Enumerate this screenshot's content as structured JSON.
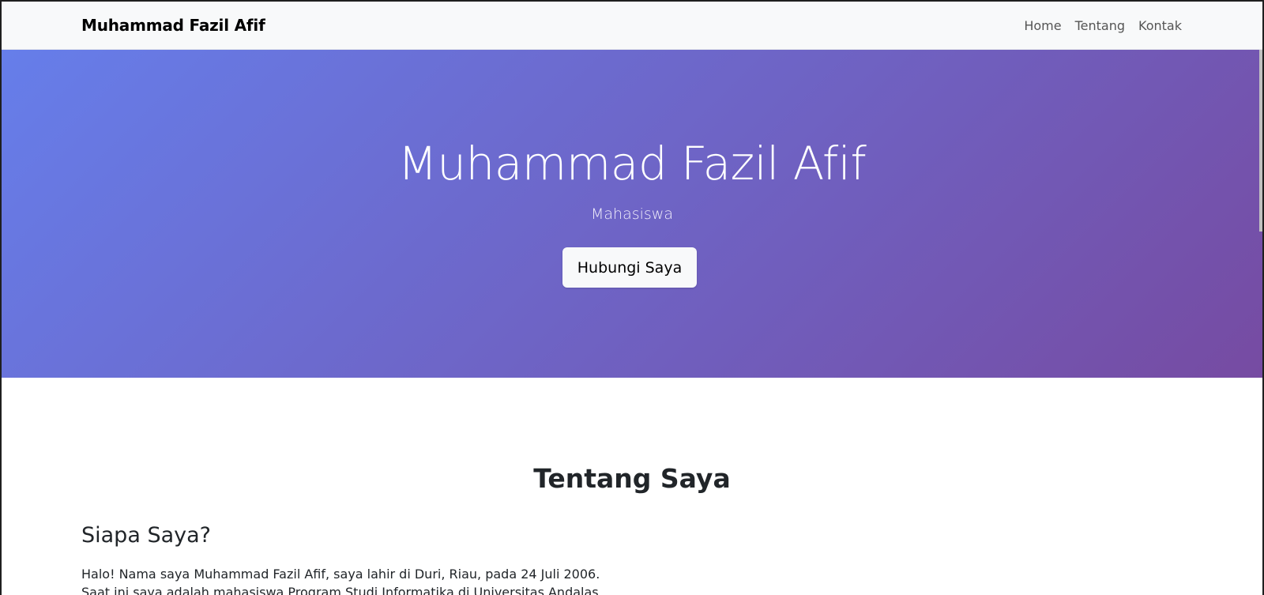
{
  "navbar": {
    "brand": "Muhammad Fazil Afif",
    "links": [
      "Home",
      "Tentang",
      "Kontak"
    ]
  },
  "hero": {
    "title": "Muhammad Fazil Afif",
    "subtitle": "Mahasiswa",
    "button_label": "Hubungi Saya"
  },
  "about": {
    "heading": "Tentang Saya",
    "subheading": "Siapa Saya?",
    "paragraph": "Halo! Nama saya Muhammad Fazil Afif, saya lahir di Duri, Riau, pada 24 Juli 2006. Saat ini saya adalah mahasiswa Program Studi Informatika di Universitas Andalas. Saya memiliki"
  },
  "colors": {
    "hero_gradient_start": "#667eea",
    "hero_gradient_end": "#764ba2",
    "navbar_bg": "#f8f9fa",
    "button_bg": "#f8f9fa"
  }
}
